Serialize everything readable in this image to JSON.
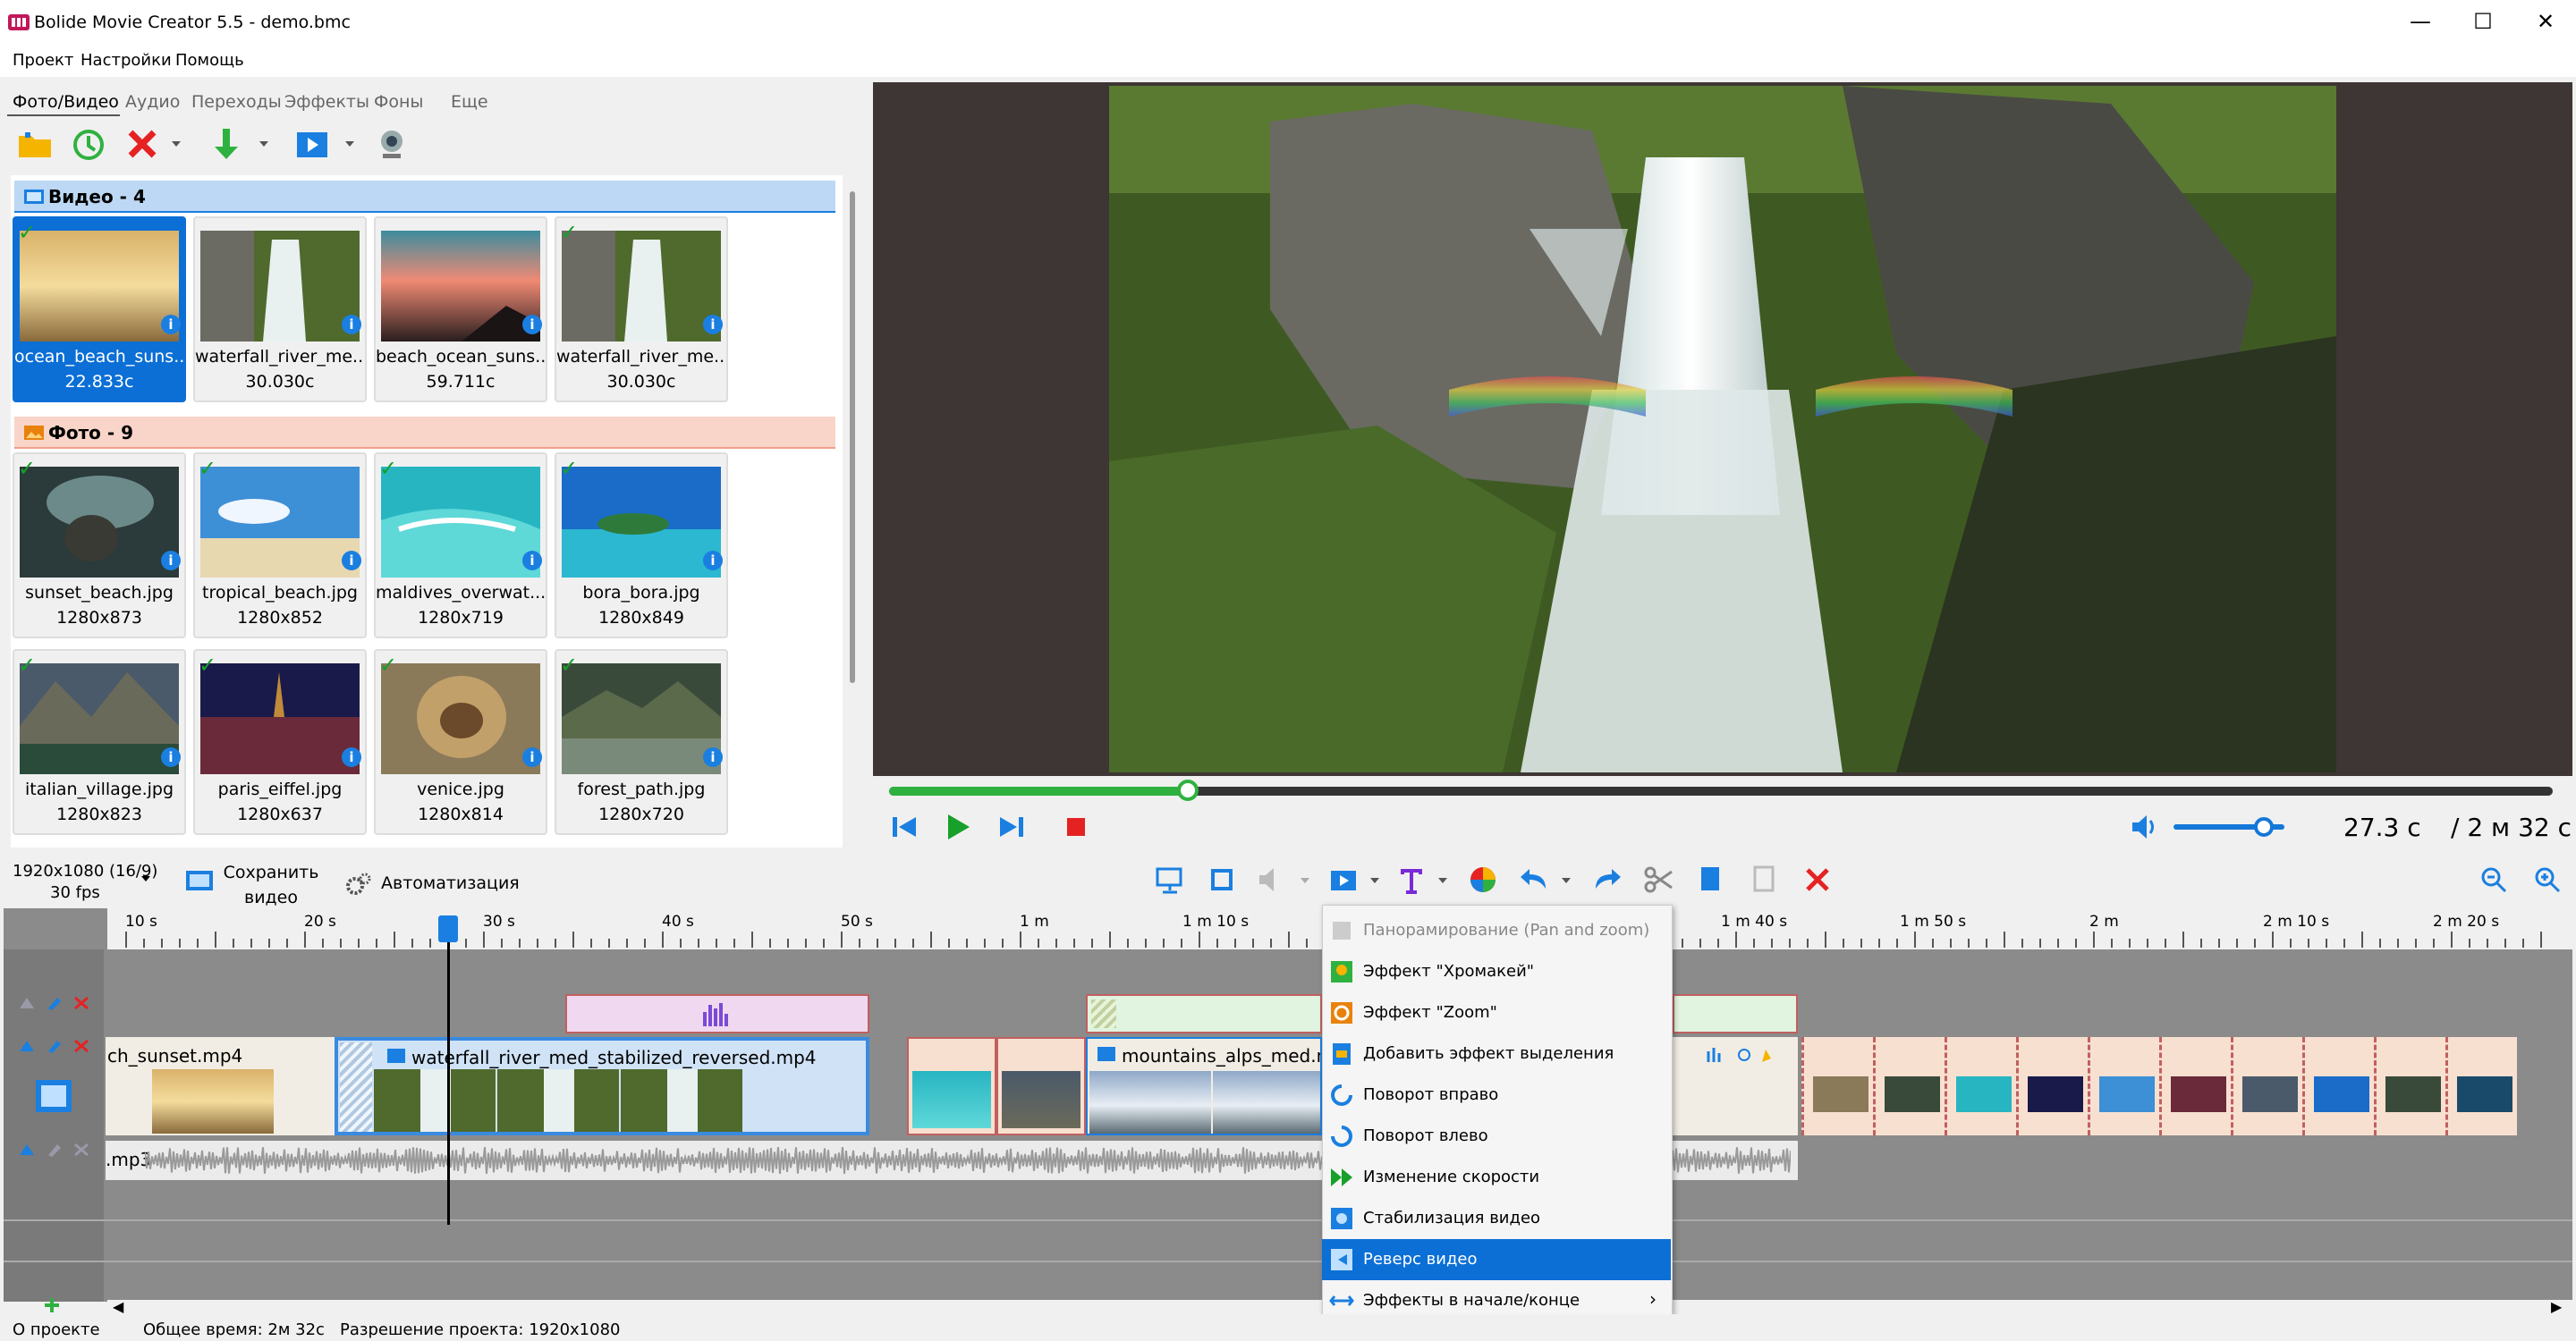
{
  "window": {
    "title": "Bolide Movie Creator 5.5 - demo.bmc",
    "minimize": "—",
    "maximize": "☐",
    "close": "✕"
  },
  "menubar": {
    "items": [
      "Проект",
      "Настройки",
      "Помощь"
    ]
  },
  "tabs": [
    "Фото/Видео",
    "Аудио",
    "Переходы",
    "Эффекты",
    "Фоны",
    "Еще"
  ],
  "groups": {
    "video": "Видео - 4",
    "photo": "Фото - 9"
  },
  "video_tiles": [
    {
      "name": "ocean_beach_suns...",
      "info": "22.833с"
    },
    {
      "name": "waterfall_river_me...",
      "info": "30.030с"
    },
    {
      "name": "beach_ocean_suns...",
      "info": "59.711с"
    },
    {
      "name": "waterfall_river_me...",
      "info": "30.030с"
    }
  ],
  "photo_tiles": [
    {
      "name": "sunset_beach.jpg",
      "info": "1280x873"
    },
    {
      "name": "tropical_beach.jpg",
      "info": "1280x852"
    },
    {
      "name": "maldives_overwat...",
      "info": "1280x719"
    },
    {
      "name": "bora_bora.jpg",
      "info": "1280x849"
    },
    {
      "name": "italian_village.jpg",
      "info": "1280x823"
    },
    {
      "name": "paris_eiffel.jpg",
      "info": "1280x637"
    },
    {
      "name": "venice.jpg",
      "info": "1280x814"
    },
    {
      "name": "forest_path.jpg",
      "info": "1280x720"
    }
  ],
  "player": {
    "current_time": "27.3 с",
    "total_time": "/ 2 м 32 с",
    "progress": 0.18,
    "volume": 0.75
  },
  "timeline_toolbar": {
    "resolution": "1920x1080 (16/9)",
    "fps": "30 fps",
    "save_video": "Сохранить видео",
    "automation": "Автоматизация"
  },
  "ruler_labels": [
    "10 s",
    "20 s",
    "30 s",
    "40 s",
    "50 s",
    "1 m",
    "1 m 10 s",
    "1 m 40 s",
    "1 m 50 s",
    "2 m",
    "2 m 10 s",
    "2 m 20 s"
  ],
  "clips": {
    "video1": "ch_sunset.mp4",
    "video2": "waterfall_river_med_stabilized_reversed.mp4",
    "video3": "mountains_alps_med.mp",
    "audio": ".mp3"
  },
  "context_menu": [
    {
      "label": "Панорамирование (Pan and zoom)",
      "disabled": true
    },
    {
      "label": "Эффект \"Хромакей\""
    },
    {
      "label": "Эффект \"Zoom\""
    },
    {
      "label": "Добавить эффект выделения"
    },
    {
      "label": "Поворот вправо"
    },
    {
      "label": "Поворот влево"
    },
    {
      "label": "Изменение скорости"
    },
    {
      "label": "Стабилизация видео"
    },
    {
      "label": "Реверс видео",
      "active": true
    },
    {
      "label": "Эффекты в начале/конце",
      "submenu": "›"
    }
  ],
  "statusbar": {
    "about": "О проекте",
    "total_time": "Общее время: 2м 32с",
    "resolution": "Разрешение проекта:  1920x1080"
  },
  "colors": {
    "accent": "#0b6fd6",
    "green": "#2fb13f",
    "video_group": "#bcd8f4",
    "photo_group": "#f8d5c8",
    "clip_border": "#c06060"
  }
}
